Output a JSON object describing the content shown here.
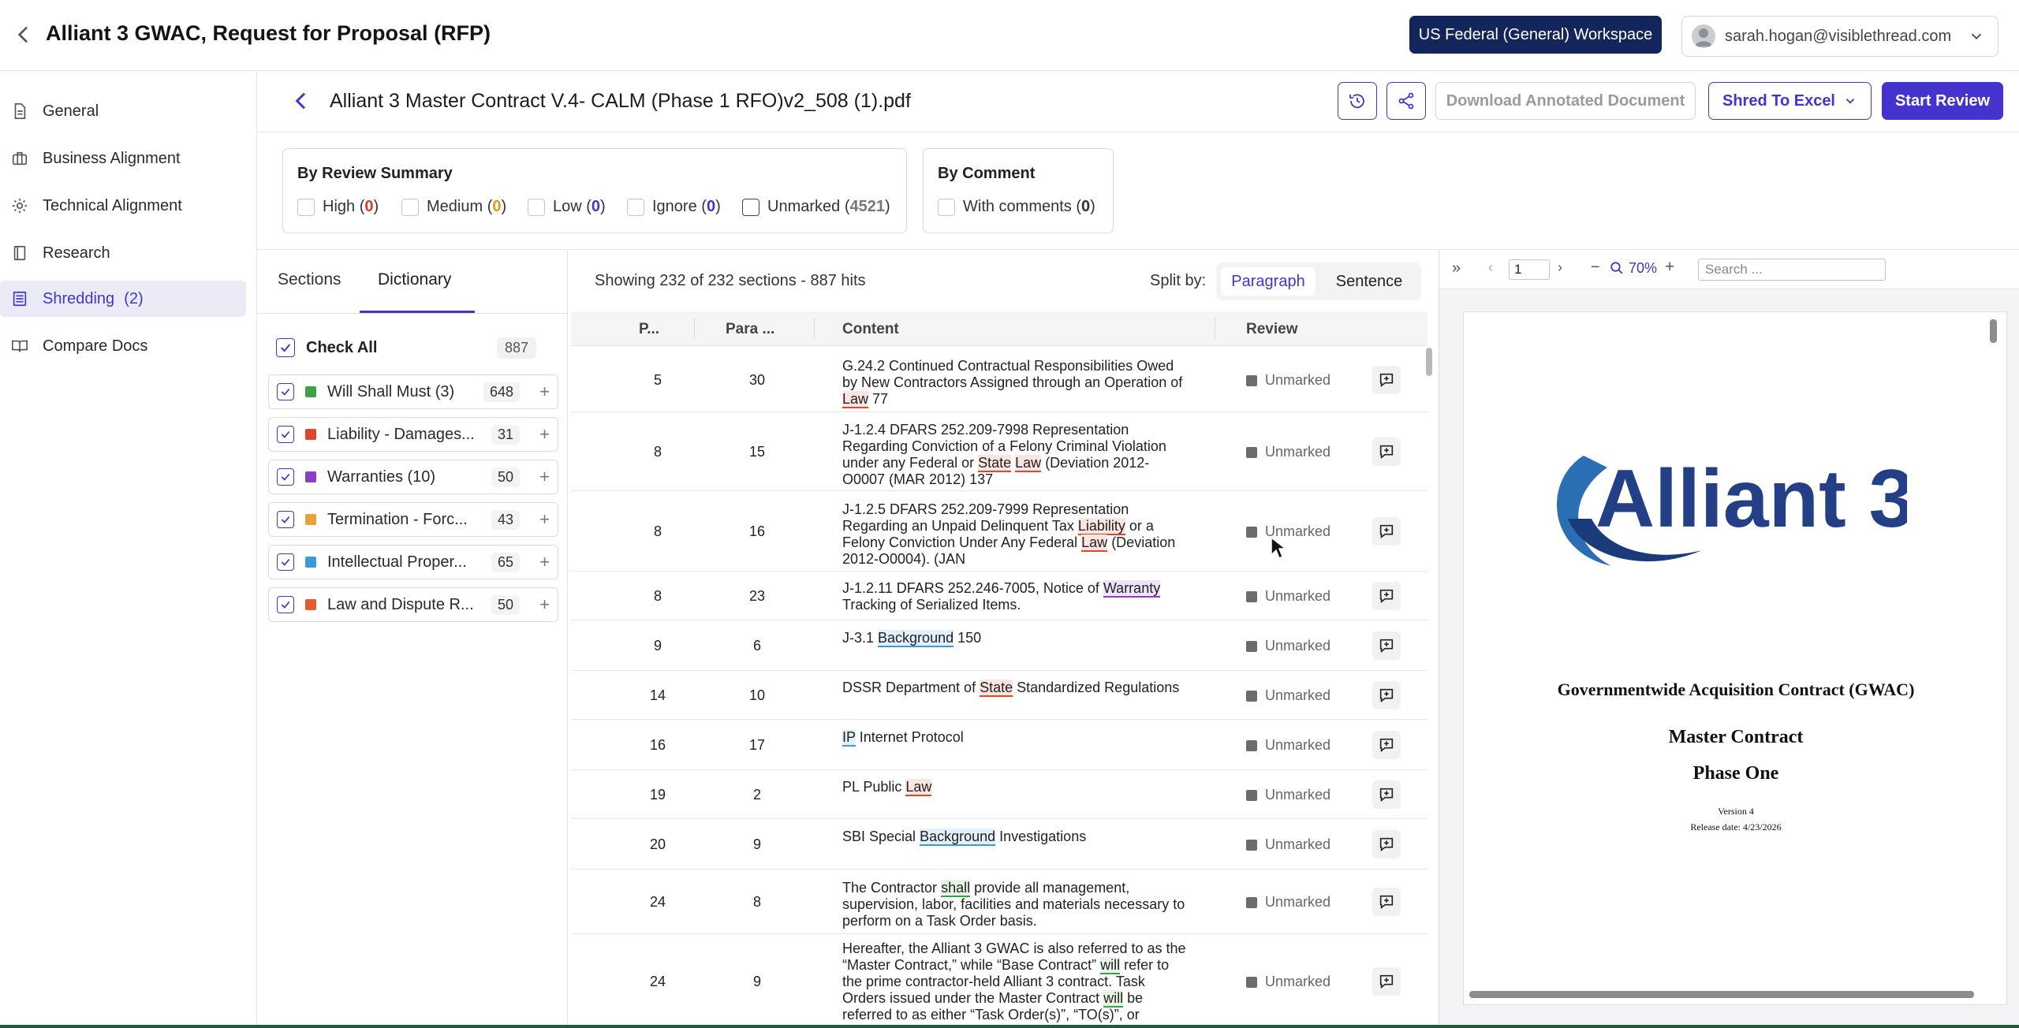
{
  "app": {
    "title": "Alliant 3 GWAC, Request for Proposal (RFP)",
    "workspace": "US Federal (General) Workspace",
    "user_email": "sarah.hogan@visiblethread.com"
  },
  "sidebar": {
    "items": [
      {
        "label": "General",
        "icon": "document-icon"
      },
      {
        "label": "Business Alignment",
        "icon": "briefcase-icon"
      },
      {
        "label": "Technical Alignment",
        "icon": "gear-icon"
      },
      {
        "label": "Research",
        "icon": "book-icon"
      },
      {
        "label": "Shredding",
        "count": "(2)",
        "icon": "list-icon",
        "active": true
      },
      {
        "label": "Compare Docs",
        "icon": "open-book-icon"
      }
    ]
  },
  "file": {
    "name": "Alliant 3 Master Contract V.4- CALM (Phase 1 RFO)v2_508 (1).pdf",
    "download_label": "Download Annotated Document",
    "shred_label": "Shred To Excel",
    "review_label": "Start Review"
  },
  "filters": {
    "review_summary": {
      "title": "By Review Summary",
      "options": [
        {
          "label": "High",
          "count": "0"
        },
        {
          "label": "Medium",
          "count": "0"
        },
        {
          "label": "Low",
          "count": "0"
        },
        {
          "label": "Ignore",
          "count": "0"
        },
        {
          "label": "Unmarked",
          "count": "4521"
        }
      ]
    },
    "comment": {
      "title": "By Comment",
      "options": [
        {
          "label": "With comments",
          "count": "0"
        }
      ]
    }
  },
  "dictionary_panel": {
    "tabs": [
      "Sections",
      "Dictionary"
    ],
    "check_all_label": "Check All",
    "check_all_count": "887",
    "items": [
      {
        "label": "Will Shall Must (3)",
        "count": "648",
        "color": "#3f9f46"
      },
      {
        "label": "Liability - Damages...",
        "count": "31",
        "color": "#e0452f"
      },
      {
        "label": "Warranties (10)",
        "count": "50",
        "color": "#8a3fc4"
      },
      {
        "label": "Termination - Forc...",
        "count": "43",
        "color": "#e9a23b"
      },
      {
        "label": "Intellectual Proper...",
        "count": "65",
        "color": "#3a9bd8"
      },
      {
        "label": "Law and Dispute R...",
        "count": "50",
        "color": "#e65a32"
      }
    ]
  },
  "results": {
    "info": "Showing 232 of 232 sections - 887 hits",
    "split_label": "Split by:",
    "split_options": [
      "Paragraph",
      "Sentence"
    ],
    "columns": [
      "P...",
      "Para ...",
      "Content",
      "Review"
    ],
    "rows": [
      {
        "page": "5",
        "para": "30",
        "review": "Unmarked"
      },
      {
        "page": "8",
        "para": "15",
        "review": "Unmarked"
      },
      {
        "page": "8",
        "para": "16",
        "review": "Unmarked"
      },
      {
        "page": "8",
        "para": "23",
        "review": "Unmarked"
      },
      {
        "page": "9",
        "para": "6",
        "review": "Unmarked"
      },
      {
        "page": "14",
        "para": "10",
        "review": "Unmarked"
      },
      {
        "page": "16",
        "para": "17",
        "review": "Unmarked"
      },
      {
        "page": "19",
        "para": "2",
        "review": "Unmarked"
      },
      {
        "page": "20",
        "para": "9",
        "review": "Unmarked"
      },
      {
        "page": "24",
        "para": "8",
        "review": "Unmarked"
      },
      {
        "page": "24",
        "para": "9",
        "review": "Unmarked"
      }
    ],
    "contents": [
      [
        {
          "t": "G.24.2 Continued Contractual Responsibilities Owed by New Contractors Assigned through an Operation of "
        },
        {
          "t": "Law",
          "hl": "red"
        },
        {
          "t": " 77"
        }
      ],
      [
        {
          "t": "J-1.2.4 DFARS 252.209-7998 Representation Regarding Conviction of a Felony Criminal Violation under any Federal or "
        },
        {
          "t": "State",
          "hl": "red"
        },
        {
          "t": " "
        },
        {
          "t": "Law",
          "hl": "red"
        },
        {
          "t": " (Deviation 2012-O0007 (MAR 2012) 137"
        }
      ],
      [
        {
          "t": "J-1.2.5 DFARS 252.209-7999 Representation Regarding an Unpaid Delinquent Tax "
        },
        {
          "t": "Liability",
          "hl": "red"
        },
        {
          "t": " or a Felony Conviction Under Any Federal "
        },
        {
          "t": "Law",
          "hl": "red"
        },
        {
          "t": " (Deviation 2012-O0004). (JAN"
        }
      ],
      [
        {
          "t": "J-1.2.11 DFARS 252.246-7005, Notice of "
        },
        {
          "t": "Warranty",
          "hl": "purple"
        },
        {
          "t": " Tracking of Serialized Items."
        }
      ],
      [
        {
          "t": "J-3.1 "
        },
        {
          "t": "Background",
          "hl": "blue"
        },
        {
          "t": " 150"
        }
      ],
      [
        {
          "t": "DSSR Department of "
        },
        {
          "t": "State",
          "hl": "red"
        },
        {
          "t": " Standardized Regulations"
        }
      ],
      [
        {
          "t": "IP",
          "hl": "blue"
        },
        {
          "t": " Internet Protocol"
        }
      ],
      [
        {
          "t": "PL Public "
        },
        {
          "t": "Law",
          "hl": "red"
        }
      ],
      [
        {
          "t": "SBI Special "
        },
        {
          "t": "Background",
          "hl": "blue"
        },
        {
          "t": " Investigations"
        }
      ],
      [
        {
          "t": "The Contractor "
        },
        {
          "t": "shall",
          "hl": "green"
        },
        {
          "t": " provide all management, supervision, labor, facilities and materials necessary to perform on a Task Order basis."
        }
      ],
      [
        {
          "t": "Hereafter, the Alliant 3 GWAC is also referred to as the “Master Contract,” while “Base Contract” "
        },
        {
          "t": "will",
          "hl": "green"
        },
        {
          "t": " refer to the prime contractor-held Alliant 3 contract. Task Orders issued under the Master Contract "
        },
        {
          "t": "will",
          "hl": "green"
        },
        {
          "t": " be referred to as either “Task Order(s)”, “TO(s)”, or"
        }
      ]
    ]
  },
  "pdf_viewer": {
    "page_number": "1",
    "zoom": "70%",
    "search_placeholder": "Search ...",
    "page": {
      "logo_text": "Alliant 3",
      "heading": "Governmentwide Acquisition Contract (GWAC)",
      "title": "Master Contract",
      "subtitle": "Phase One",
      "version": "Version 4",
      "release": "Release date: 4/23/2026"
    }
  }
}
